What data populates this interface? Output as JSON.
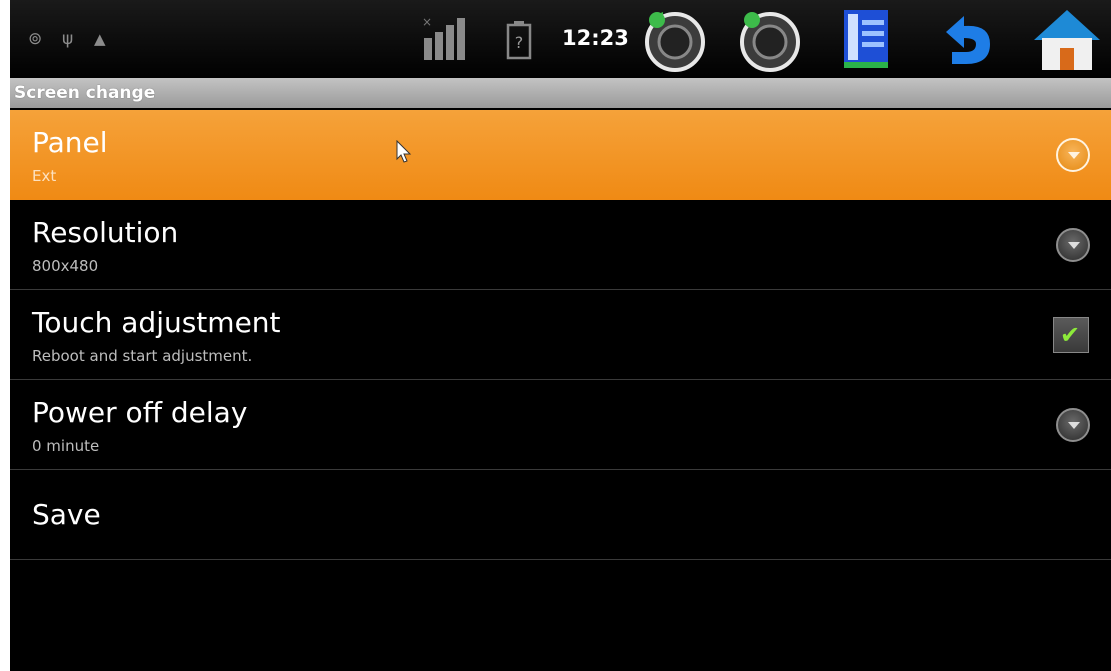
{
  "status_bar": {
    "notification_icons": [
      "gps-icon",
      "usb-icon",
      "android-debug-icon"
    ],
    "signal_icon": "signal-strength-icon",
    "battery_icon": "battery-unknown-icon",
    "time": "12:23",
    "buttons": [
      {
        "name": "volume-down-icon"
      },
      {
        "name": "volume-up-icon"
      },
      {
        "name": "menu-icon"
      },
      {
        "name": "back-icon"
      },
      {
        "name": "home-icon"
      }
    ]
  },
  "section": {
    "title": "Screen change"
  },
  "settings": [
    {
      "title": "Panel",
      "summary": "Ext",
      "control": "dropdown",
      "selected": true
    },
    {
      "title": "Resolution",
      "summary": "800x480",
      "control": "dropdown",
      "selected": false
    },
    {
      "title": "Touch adjustment",
      "summary": "Reboot and start adjustment.",
      "control": "checkbox",
      "checked": true
    },
    {
      "title": "Power off delay",
      "summary": "0 minute",
      "control": "dropdown",
      "selected": false
    },
    {
      "title": "Save",
      "control": "none"
    }
  ],
  "colors": {
    "selected_row": "#f29a2b",
    "background": "#000000",
    "header": "#a8a8a8",
    "checkmark": "#8dea3a"
  }
}
